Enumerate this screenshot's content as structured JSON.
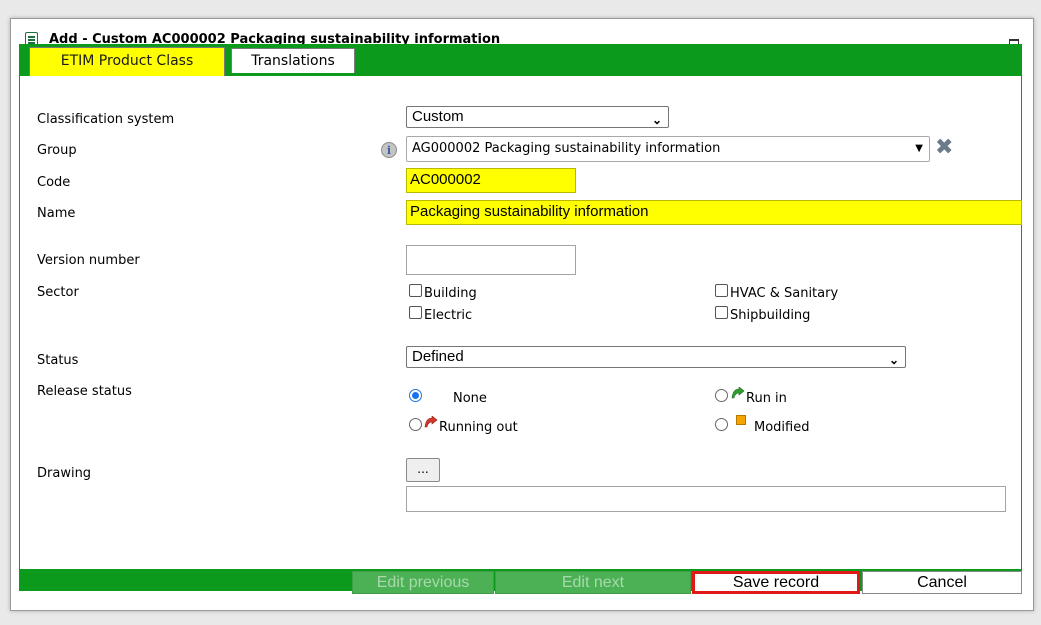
{
  "window": {
    "title": "Add - Custom AC000002 Packaging sustainability information"
  },
  "tabs": [
    {
      "label": "ETIM Product Class",
      "active": true
    },
    {
      "label": "Translations",
      "active": false
    }
  ],
  "form": {
    "classification_system": {
      "label": "Classification system",
      "value": "Custom"
    },
    "group": {
      "label": "Group",
      "value": "AG000002 Packaging sustainability information"
    },
    "code": {
      "label": "Code",
      "value": "AC000002"
    },
    "name": {
      "label": "Name",
      "value": "Packaging sustainability information"
    },
    "version_number": {
      "label": "Version number",
      "value": ""
    },
    "sector": {
      "label": "Sector",
      "options": [
        {
          "label": "Building",
          "checked": false
        },
        {
          "label": "HVAC & Sanitary",
          "checked": false
        },
        {
          "label": "Electric",
          "checked": false
        },
        {
          "label": "Shipbuilding",
          "checked": false
        }
      ]
    },
    "status": {
      "label": "Status",
      "value": "Defined"
    },
    "release_status": {
      "label": "Release status",
      "options": [
        {
          "label": "None",
          "checked": true,
          "icon": "none"
        },
        {
          "label": "Run in",
          "checked": false,
          "icon": "run-in-icon"
        },
        {
          "label": "Running out",
          "checked": false,
          "icon": "running-out-icon"
        },
        {
          "label": "Modified",
          "checked": false,
          "icon": "modified-icon"
        }
      ]
    },
    "drawing": {
      "label": "Drawing",
      "browse_label": "...",
      "value": ""
    }
  },
  "footer": {
    "edit_previous": "Edit previous",
    "edit_next": "Edit next",
    "save": "Save record",
    "cancel": "Cancel"
  },
  "colors": {
    "accent_green": "#0c9a1c",
    "highlight_yellow": "#ffff00",
    "save_outline_red": "#e01818"
  }
}
